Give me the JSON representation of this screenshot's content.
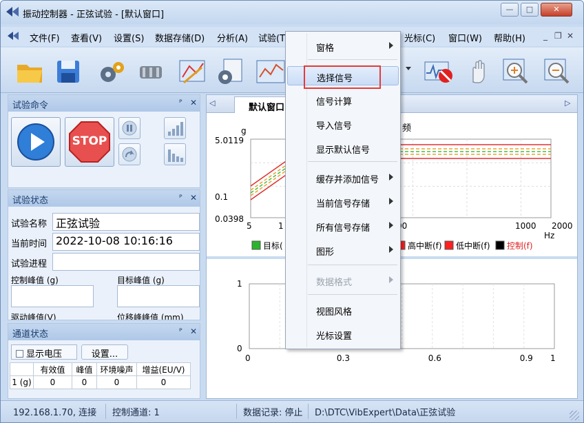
{
  "window": {
    "title": "振动控制器 - 正弦试验 - [默认窗口]",
    "controls": {
      "minimize": "—",
      "maximize": "□",
      "close": "✕"
    }
  },
  "menubar": {
    "items": [
      "文件(F)",
      "查看(V)",
      "设置(S)",
      "数据存储(D)",
      "分析(A)",
      "试验(T)",
      "光标(C)",
      "窗口(W)",
      "帮助(H)"
    ],
    "mdi": {
      "minimize": "_",
      "restore": "❐",
      "close": "✕"
    }
  },
  "toolbar": {
    "icons": [
      "open-folder-icon",
      "save-icon",
      "settings-gears-icon",
      "cylinder-icon",
      "edit-profile-icon",
      "report-icon",
      "chart-icon",
      "stop-monitor-icon",
      "hand-pan-icon",
      "zoom-in-icon",
      "zoom-out-icon"
    ]
  },
  "panels": {
    "command": {
      "title": "试验命令",
      "pin": "ᴾ",
      "close": "✕",
      "stop_label": "STOP"
    },
    "status": {
      "title": "试验状态",
      "pin": "ᴾ",
      "close": "✕",
      "name_label": "试验名称",
      "name_value": "正弦试验",
      "time_label": "当前时间",
      "time_value": "2022-10-08 10:16:16",
      "progress_label": "试验进程",
      "control_peak_label": "控制峰值 (g)",
      "target_peak_label": "目标峰值 (g)",
      "drive_peak_label": "驱动峰值(V)",
      "disp_peak_label": "位移峰峰值 (mm)"
    },
    "channel": {
      "title": "通道状态",
      "pin": "ᴾ",
      "close": "✕",
      "show_voltage_label": "显示电压",
      "settings_button": "设置...",
      "columns": [
        "",
        "有效值",
        "峰值",
        "环境噪声",
        "增益(EU/V)"
      ],
      "rows": [
        [
          "1 (g)",
          "0",
          "0",
          "0",
          "0"
        ]
      ]
    }
  },
  "document": {
    "tab_label": "默认窗口",
    "tab_prev": "◁",
    "tab_next": "▷"
  },
  "chart_data": [
    {
      "type": "line",
      "title": "频",
      "ylabel": "g",
      "xlabel": "Hz",
      "y_ticks": [
        "5.0119",
        "0.1",
        "0.0398"
      ],
      "x_ticks": [
        "5",
        "1",
        "00",
        "1000",
        "2000"
      ],
      "legend": [
        "目标(",
        "高中断(f)",
        "低中断(f)",
        "控制(f)"
      ],
      "legend_colors": [
        "#2bb52b",
        "#ff2020",
        "#ff2020",
        "#000000"
      ],
      "series_colors": [
        "#e03030",
        "#f0a030",
        "#40c040"
      ]
    },
    {
      "type": "line",
      "x_ticks": [
        "0",
        "0.3",
        "0.6",
        "0.9",
        "1"
      ],
      "y_ticks": [
        "1",
        "0"
      ],
      "xlim": [
        0,
        1
      ],
      "ylim": [
        0,
        1
      ]
    }
  ],
  "context_menu": {
    "items": [
      {
        "label": "窗格",
        "submenu": true,
        "disabled": false,
        "highlighted": false
      },
      {
        "label": "选择信号",
        "submenu": false,
        "disabled": false,
        "highlighted": true
      },
      {
        "label": "信号计算",
        "submenu": false,
        "disabled": false,
        "highlighted": false
      },
      {
        "label": "导入信号",
        "submenu": false,
        "disabled": false,
        "highlighted": false
      },
      {
        "label": "显示默认信号",
        "submenu": false,
        "disabled": false,
        "highlighted": false
      },
      {
        "label": "缓存并添加信号",
        "submenu": true,
        "disabled": false,
        "highlighted": false
      },
      {
        "label": "当前信号存储",
        "submenu": true,
        "disabled": false,
        "highlighted": false
      },
      {
        "label": "所有信号存储",
        "submenu": true,
        "disabled": false,
        "highlighted": false
      },
      {
        "label": "图形",
        "submenu": true,
        "disabled": false,
        "highlighted": false
      },
      {
        "label": "数据格式",
        "submenu": true,
        "disabled": true,
        "highlighted": false
      },
      {
        "label": "视图风格",
        "submenu": false,
        "disabled": false,
        "highlighted": false
      },
      {
        "label": "光标设置",
        "submenu": false,
        "disabled": false,
        "highlighted": false
      }
    ]
  },
  "statusbar": {
    "ip": "192.168.1.70, 连接",
    "control_channel": "控制通道: 1",
    "data_record": "数据记录: 停止",
    "path": "D:\\DTC\\VibExpert\\Data\\正弦试验"
  }
}
